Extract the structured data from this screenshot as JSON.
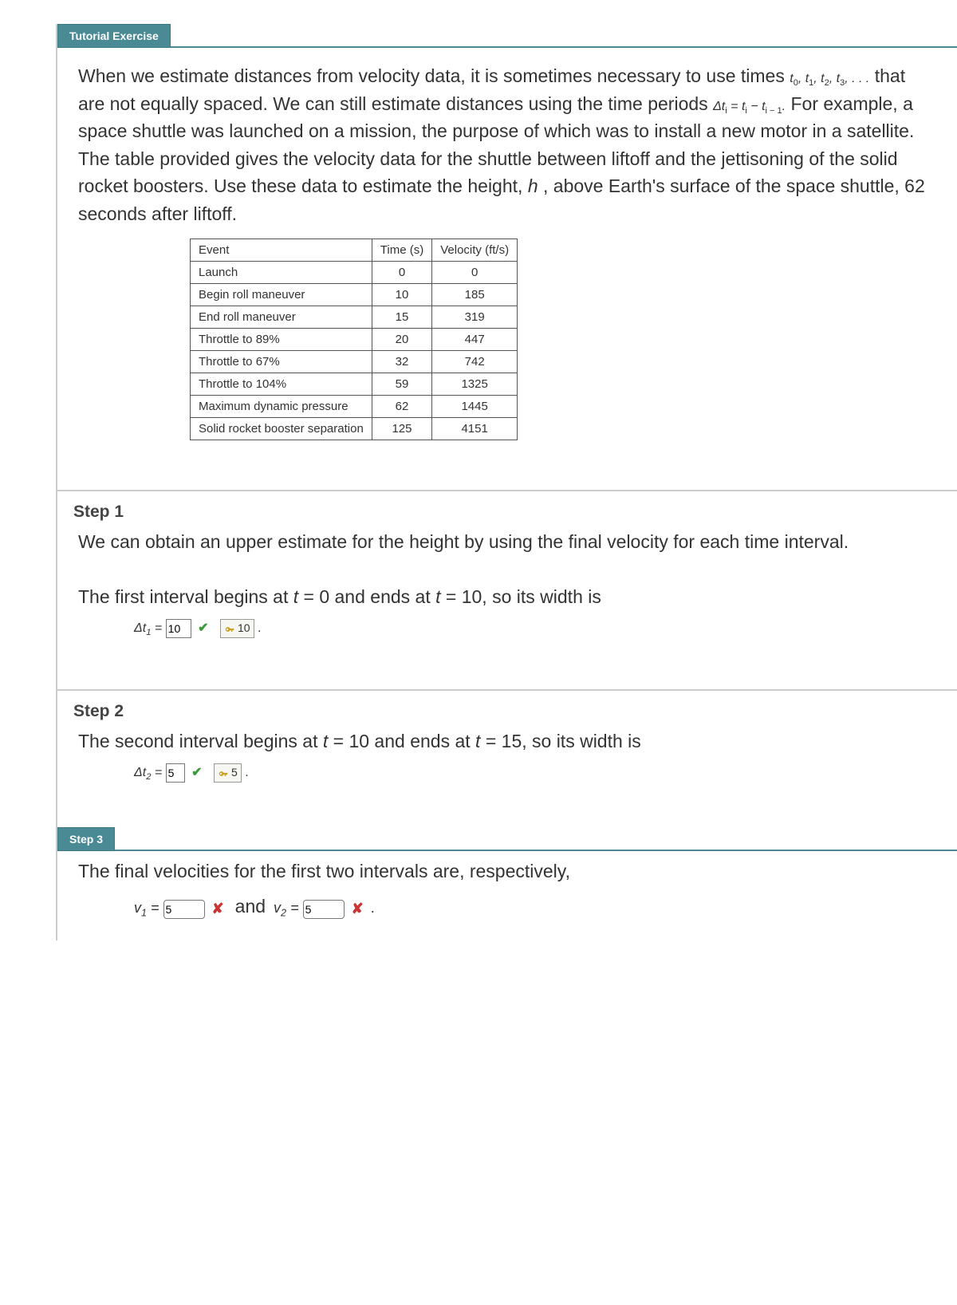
{
  "tutorial_tab": "Tutorial Exercise",
  "problem": {
    "p1_a": "When we estimate distances from velocity data, it is sometimes necessary to use times ",
    "p1_times": "t",
    "p1_b": " that are not equally spaced. We can still estimate distances using the time periods ",
    "p1_dt": "Δt",
    "p1_eq": " = t",
    "p1_eq2": " − t",
    "p1_c": " For example, a space shuttle was launched on a mission, the purpose of which was to install a new motor in a satellite. The table provided gives the velocity data for the shuttle between liftoff and the jettisoning of the solid rocket boosters. Use these data to estimate the height, ",
    "p1_h": "h",
    "p1_d": ", above Earth's surface of the space shuttle, 62 seconds after liftoff."
  },
  "table": {
    "headers": [
      "Event",
      "Time (s)",
      "Velocity (ft/s)"
    ],
    "rows": [
      {
        "event": "Launch",
        "time": "0",
        "vel": "0"
      },
      {
        "event": "Begin roll maneuver",
        "time": "10",
        "vel": "185"
      },
      {
        "event": "End roll maneuver",
        "time": "15",
        "vel": "319"
      },
      {
        "event": "Throttle to 89%",
        "time": "20",
        "vel": "447"
      },
      {
        "event": "Throttle to 67%",
        "time": "32",
        "vel": "742"
      },
      {
        "event": "Throttle to 104%",
        "time": "59",
        "vel": "1325"
      },
      {
        "event": "Maximum dynamic pressure",
        "time": "62",
        "vel": "1445"
      },
      {
        "event": "Solid rocket booster separation",
        "time": "125",
        "vel": "4151"
      }
    ]
  },
  "step1": {
    "heading": "Step 1",
    "text1": "We can obtain an upper estimate for the height by using the final velocity for each time interval.",
    "text2_a": "The first interval begins at ",
    "text2_b": " = 0 and ends at ",
    "text2_c": " = 10, so its width is",
    "dt_label": "Δt",
    "ans_value": "10",
    "hint_value": "10"
  },
  "step2": {
    "heading": "Step 2",
    "text_a": "The second interval begins at ",
    "text_b": " = 10 and ends at ",
    "text_c": " = 15, so its width is",
    "dt_label": "Δt",
    "ans_value": "5",
    "hint_value": "5"
  },
  "step3": {
    "heading": "Step 3",
    "text": "The final velocities for the first two intervals are, respectively,",
    "v1_label": "v",
    "v1_value": "5",
    "and": "and",
    "v2_label": "v",
    "v2_value": "5"
  },
  "t_var": "t",
  "period": ".",
  "ellipsis": ", . . ."
}
